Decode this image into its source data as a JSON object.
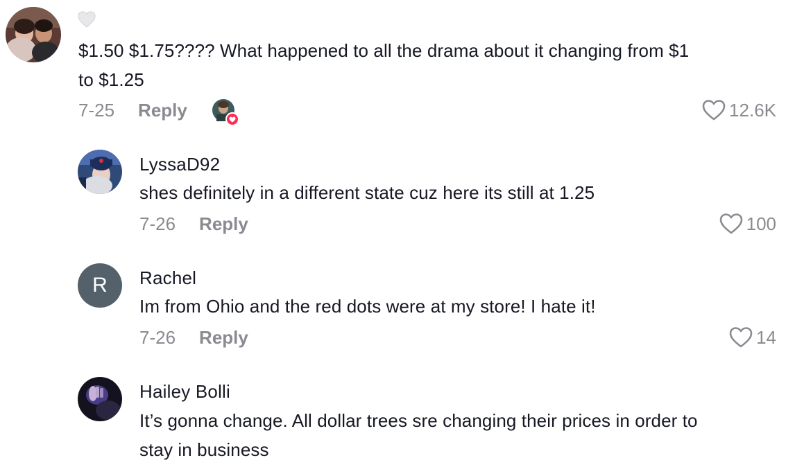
{
  "comments": [
    {
      "username": "",
      "text_line1": "$1.50 $1.75???? What happened to all the drama about it changing from $1",
      "text_line2": "to $1.25",
      "date": "7-25",
      "reply_label": "Reply",
      "likes": "12.6K"
    },
    {
      "username": "LyssaD92",
      "text": "shes definitely in a different state cuz here its still at 1.25",
      "date": "7-26",
      "reply_label": "Reply",
      "likes": "100"
    },
    {
      "username": "Rachel",
      "avatar_letter": "R",
      "text": "Im from Ohio and the red dots were at my store! I hate it!",
      "date": "7-26",
      "reply_label": "Reply",
      "likes": "14"
    },
    {
      "username": "Hailey Bolli",
      "text_line1": "It’s gonna change. All dollar trees sre changing their prices in order to",
      "text_line2": "stay in business"
    }
  ],
  "colors": {
    "text_primary": "#161823",
    "text_secondary": "#8a8b91",
    "accent_red": "#fe2c55",
    "avatar_gray": "#54616b"
  },
  "icons": {
    "like": "heart-outline-icon",
    "liked_by_creator": "heart-badge-icon"
  }
}
